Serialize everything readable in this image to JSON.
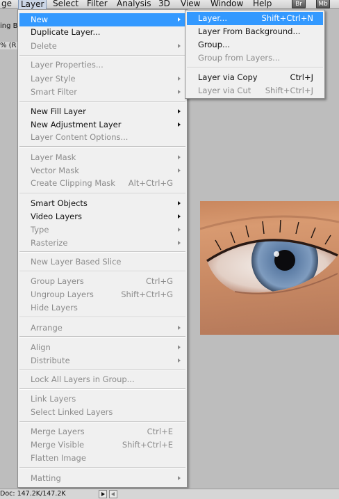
{
  "menubar": {
    "items": [
      "ge",
      "Layer",
      "Select",
      "Filter",
      "Analysis",
      "3D",
      "View",
      "Window",
      "Help"
    ],
    "badges": [
      "Br",
      "Mb"
    ]
  },
  "left_strip": {
    "line1": "ing Bo",
    "line2": "% (R"
  },
  "layer_menu": {
    "items": [
      {
        "label": "New",
        "arrow": true,
        "highlight": true
      },
      {
        "label": "Duplicate Layer..."
      },
      {
        "label": "Delete",
        "arrow": true,
        "disabled": true
      },
      {
        "label": "Layer Properties...",
        "disabled": true
      },
      {
        "label": "Layer Style",
        "arrow": true,
        "disabled": true
      },
      {
        "label": "Smart Filter",
        "arrow": true,
        "disabled": true
      },
      {
        "label": "New Fill Layer",
        "arrow": true
      },
      {
        "label": "New Adjustment Layer",
        "arrow": true
      },
      {
        "label": "Layer Content Options...",
        "disabled": true
      },
      {
        "label": "Layer Mask",
        "arrow": true,
        "disabled": true
      },
      {
        "label": "Vector Mask",
        "arrow": true,
        "disabled": true
      },
      {
        "label": "Create Clipping Mask",
        "shortcut": "Alt+Ctrl+G",
        "disabled": true
      },
      {
        "label": "Smart Objects",
        "arrow": true
      },
      {
        "label": "Video Layers",
        "arrow": true
      },
      {
        "label": "Type",
        "arrow": true,
        "disabled": true
      },
      {
        "label": "Rasterize",
        "arrow": true,
        "disabled": true
      },
      {
        "label": "New Layer Based Slice",
        "disabled": true
      },
      {
        "label": "Group Layers",
        "shortcut": "Ctrl+G",
        "disabled": true
      },
      {
        "label": "Ungroup Layers",
        "shortcut": "Shift+Ctrl+G",
        "disabled": true
      },
      {
        "label": "Hide Layers",
        "disabled": true
      },
      {
        "label": "Arrange",
        "arrow": true,
        "disabled": true
      },
      {
        "label": "Align",
        "arrow": true,
        "disabled": true
      },
      {
        "label": "Distribute",
        "arrow": true,
        "disabled": true
      },
      {
        "label": "Lock All Layers in Group...",
        "disabled": true
      },
      {
        "label": "Link Layers",
        "disabled": true
      },
      {
        "label": "Select Linked Layers",
        "disabled": true
      },
      {
        "label": "Merge Layers",
        "shortcut": "Ctrl+E",
        "disabled": true
      },
      {
        "label": "Merge Visible",
        "shortcut": "Shift+Ctrl+E",
        "disabled": true
      },
      {
        "label": "Flatten Image",
        "disabled": true
      },
      {
        "label": "Matting",
        "arrow": true,
        "disabled": true
      }
    ]
  },
  "new_submenu": {
    "items": [
      {
        "label": "Layer...",
        "shortcut": "Shift+Ctrl+N",
        "highlight": true
      },
      {
        "label": "Layer From Background..."
      },
      {
        "label": "Group..."
      },
      {
        "label": "Group from Layers...",
        "disabled": true
      },
      {
        "label": "Layer via Copy",
        "shortcut": "Ctrl+J"
      },
      {
        "label": "Layer via Cut",
        "shortcut": "Shift+Ctrl+J",
        "disabled": true
      }
    ]
  },
  "status": {
    "doc": "Doc: 147.2K/147.2K"
  },
  "colors": {
    "highlight": "#3399ff",
    "menu_bg": "#f0f0f0",
    "workspace": "#bdbdbd",
    "iris": "#6d8aab"
  }
}
